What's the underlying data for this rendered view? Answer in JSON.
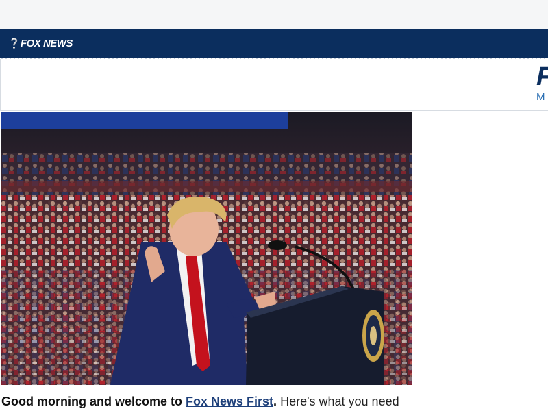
{
  "header": {
    "logo_text": "FOX NEWS",
    "logo_icon": "fox-news-logo-icon",
    "background": "#0b2e5e"
  },
  "banner": {
    "title_fragment": "F",
    "subtitle_fragment": "M",
    "title_color": "#0b2e5e",
    "subtitle_color": "#2a6fb4"
  },
  "hero_image": {
    "alt": "Man in a suit with red tie at a presidential podium before a rally crowd"
  },
  "intro": {
    "lead": "Good morning and welcome to ",
    "link_text": "Fox News First",
    "period": ".",
    "rest": " Here's what you need",
    "link_color": "#1d3f7a"
  }
}
